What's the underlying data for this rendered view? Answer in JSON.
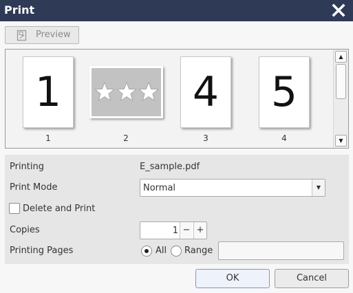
{
  "dialog": {
    "title": "Print",
    "close_icon": "close-icon"
  },
  "toolbar": {
    "preview_label": "Preview",
    "preview_icon": "preview-icon"
  },
  "thumbnails": {
    "pages": [
      {
        "label": "1",
        "content": "1"
      },
      {
        "label": "2",
        "content": "★★★"
      },
      {
        "label": "3",
        "content": "4"
      },
      {
        "label": "4",
        "content": "5"
      }
    ]
  },
  "settings": {
    "printing_label": "Printing",
    "printing_value": "E_sample.pdf",
    "print_mode_label": "Print Mode",
    "print_mode_value": "Normal",
    "delete_and_print_label": "Delete and Print",
    "delete_and_print_checked": false,
    "copies_label": "Copies",
    "copies_value": "1",
    "minus_label": "−",
    "plus_label": "+",
    "printing_pages_label": "Printing Pages",
    "all_label": "All",
    "range_label": "Range",
    "range_value": "",
    "selected_pages_option": "All"
  },
  "buttons": {
    "ok_label": "OK",
    "cancel_label": "Cancel"
  },
  "colors": {
    "titlebar": "#2f3a56",
    "ok_border": "#7d97c8"
  }
}
